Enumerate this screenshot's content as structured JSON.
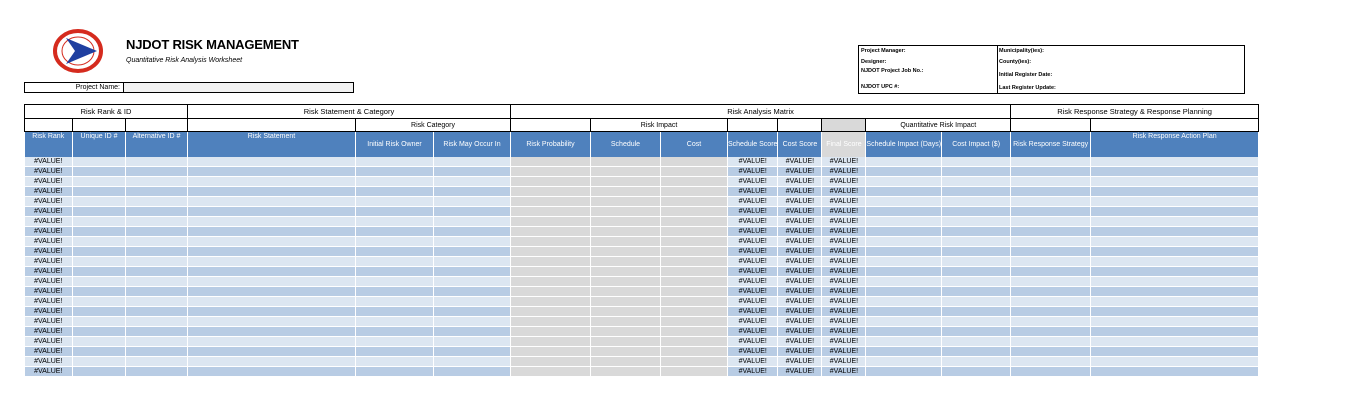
{
  "header": {
    "title": "NJDOT RISK MANAGEMENT",
    "subtitle": "Quantitative Risk Analysis Worksheet",
    "project_name_label": "Project Name:",
    "logo_icon": "njdot-logo-icon"
  },
  "info": {
    "project_manager": "Project Manager:",
    "designer": "Designer:",
    "job_no": "NJDOT Project Job No.:",
    "upc": "NJDOT UPC #:",
    "municipality": "Municipality(ies):",
    "county": "County(ies):",
    "initial_register_date": "Initial Register Date:",
    "last_register_update": "Last Register Update:"
  },
  "groups": {
    "rank_id": "Risk Rank & ID",
    "statement_category": "Risk Statement & Category",
    "analysis_matrix": "Risk Analysis Matrix",
    "response": "Risk Response Strategy & Response Planning"
  },
  "subgroups": {
    "category": "Risk Category",
    "impact": "Risk Impact",
    "quant_impact": "Quantitative Risk Impact"
  },
  "columns": {
    "risk_rank": "Risk Rank",
    "unique_id": "Unique ID #",
    "alt_id": "Alternative ID #",
    "statement": "Risk Statement",
    "owner": "Initial Risk Owner",
    "may_occur": "Risk May Occur In",
    "probability": "Risk Probability",
    "schedule": "Schedule",
    "cost": "Cost",
    "schedule_score": "Schedule Score",
    "cost_score": "Cost Score",
    "final_score": "Final Score",
    "schedule_impact": "Schedule Impact (Days)",
    "cost_impact": "Cost Impact ($)",
    "response_strategy": "Risk Response Strategy",
    "action_plan": "Risk Response Action Plan"
  },
  "error_value": "#VALUE!",
  "row_count": 22,
  "colors": {
    "header_blue": "#4f81bd",
    "row_light": "#dce6f1",
    "row_dark": "#b8cce4",
    "gray": "#d9d9d9"
  }
}
